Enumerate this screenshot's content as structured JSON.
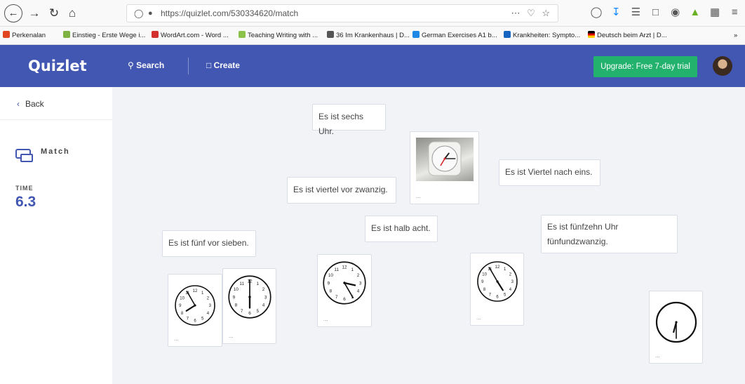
{
  "browser": {
    "url": "https://quizlet.com/530334620/match",
    "bookmarks": [
      {
        "label": "Perkenalan",
        "color": "#e0461f"
      },
      {
        "label": "Einstieg - Erste Wege i...",
        "color": "#7cb342"
      },
      {
        "label": "WordArt.com - Word ...",
        "color": "#d32f2f"
      },
      {
        "label": "Teaching Writing with ...",
        "color": "#8bc34a"
      },
      {
        "label": "36 Im Krankenhaus | D...",
        "color": "#555555"
      },
      {
        "label": "German Exercises A1 b...",
        "color": "#1e88e5"
      },
      {
        "label": "Krankheiten: Sympto...",
        "color": "#1565c0"
      },
      {
        "label": "Deutsch beim Arzt | D...",
        "color": "#000000"
      }
    ]
  },
  "header": {
    "logo": "Quizlet",
    "search_label": "Search",
    "create_label": "Create",
    "upgrade_label": "Upgrade: Free 7-day trial"
  },
  "sidebar": {
    "back_label": "Back",
    "mode_label": "Match",
    "time_label": "TIME",
    "time_value": "6.3"
  },
  "game": {
    "text_tiles": [
      "Es ist sechs Uhr.",
      "Es ist viertel vor zwanzig.",
      "Es ist Viertel nach eins.",
      "Es ist halb acht.",
      "Es ist fünfzehn Uhr fünfundzwanzig.",
      "Es ist fünf vor sieben."
    ],
    "image_tile_dots": "...",
    "clocks": [
      {
        "name": "clock-7-55",
        "hour": 7,
        "minute": 55
      },
      {
        "name": "clock-6-00",
        "hour": 6,
        "minute": 0
      },
      {
        "name": "clock-3-25",
        "hour": 3,
        "minute": 25
      },
      {
        "name": "clock-6-30",
        "hour": 6,
        "minute": 30
      },
      {
        "name": "clock-4-55",
        "hour": 4,
        "minute": 55
      },
      {
        "name": "clock-photo-1-15",
        "hour": 1,
        "minute": 15
      }
    ]
  }
}
